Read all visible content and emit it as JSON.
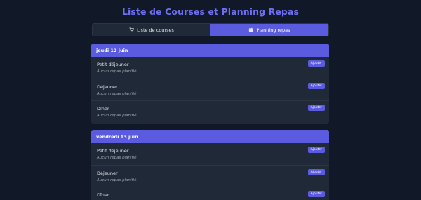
{
  "header": {
    "title": "Liste de Courses et Planning Repas"
  },
  "tabs": [
    {
      "label": "Liste de courses",
      "icon": "cart-icon",
      "active": false
    },
    {
      "label": "Planning repas",
      "icon": "calendar-icon",
      "active": true
    }
  ],
  "days": [
    {
      "label": "jeudi 12 juin",
      "meals": [
        {
          "name": "Petit déjeuner",
          "status": "Aucun repas planifié",
          "button": "Ajouter"
        },
        {
          "name": "Déjeuner",
          "status": "Aucun repas planifié",
          "button": "Ajouter"
        },
        {
          "name": "Dîner",
          "status": "Aucun repas planifié",
          "button": "Ajouter"
        }
      ]
    },
    {
      "label": "vendredi 13 juin",
      "meals": [
        {
          "name": "Petit déjeuner",
          "status": "Aucun repas planifié",
          "button": "Ajouter"
        },
        {
          "name": "Déjeuner",
          "status": "Aucun repas planifié",
          "button": "Ajouter"
        },
        {
          "name": "Dîner",
          "status": "",
          "button": "Ajouter"
        }
      ]
    }
  ],
  "colors": {
    "accent": "#5b5be0",
    "title": "#6d6ef2",
    "background": "#111827",
    "panel": "#1f2937"
  }
}
